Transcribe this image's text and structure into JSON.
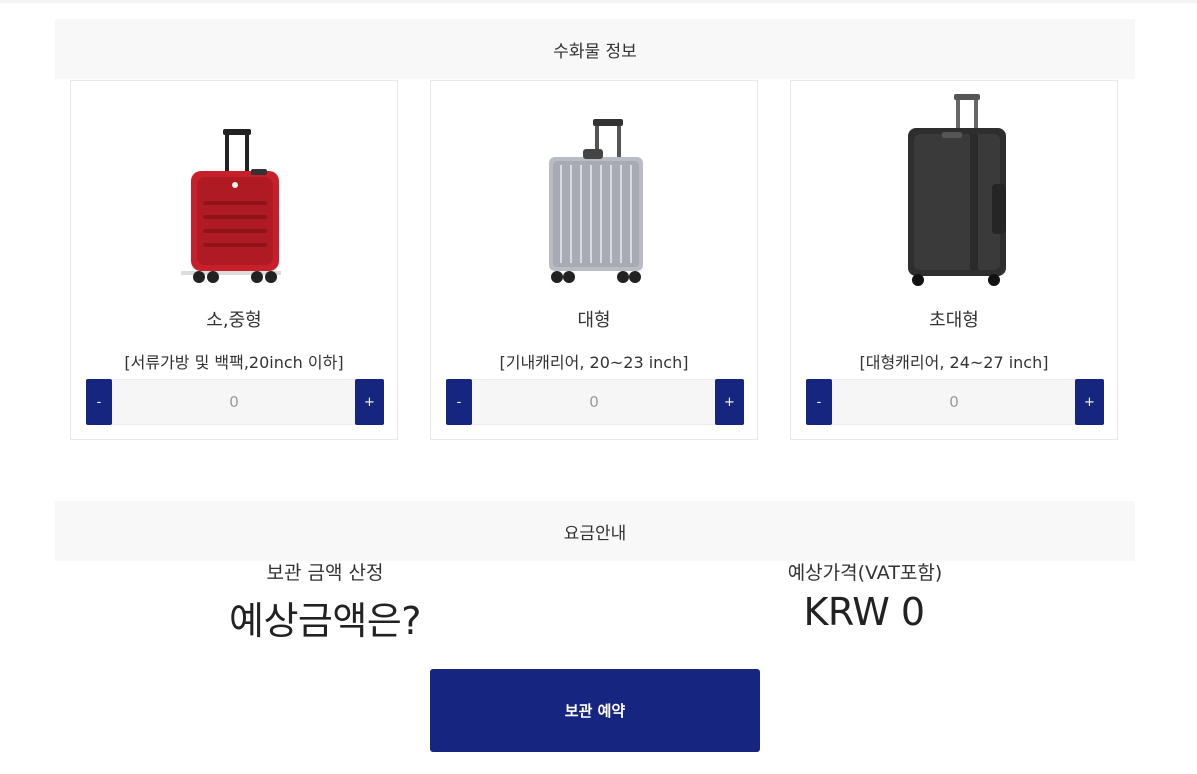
{
  "luggage_section": {
    "title": "수화물 정보"
  },
  "items": [
    {
      "name": "소,중형",
      "desc": "[서류가방 및 백팩,20inch 이하]",
      "quantity": "0",
      "minus_label": "-",
      "plus_label": "+",
      "color": "#c8202a"
    },
    {
      "name": "대형",
      "desc": "[기내캐리어, 20~23 inch]",
      "quantity": "0",
      "minus_label": "-",
      "plus_label": "+",
      "color": "#b9bcc4"
    },
    {
      "name": "초대형",
      "desc": "[대형캐리어, 24~27 inch]",
      "quantity": "0",
      "minus_label": "-",
      "plus_label": "+",
      "color": "#2e2e2e"
    }
  ],
  "fee_section": {
    "title": "요금안내",
    "estimate_label": "보관 금액 산정",
    "estimate_value": "예상금액은?",
    "price_label": "예상가격(VAT포함)",
    "price_value": "KRW 0"
  },
  "reserve_button": {
    "label": "보관 예약"
  },
  "colors": {
    "accent": "#16257f",
    "header_bg": "#f8f8f8"
  }
}
